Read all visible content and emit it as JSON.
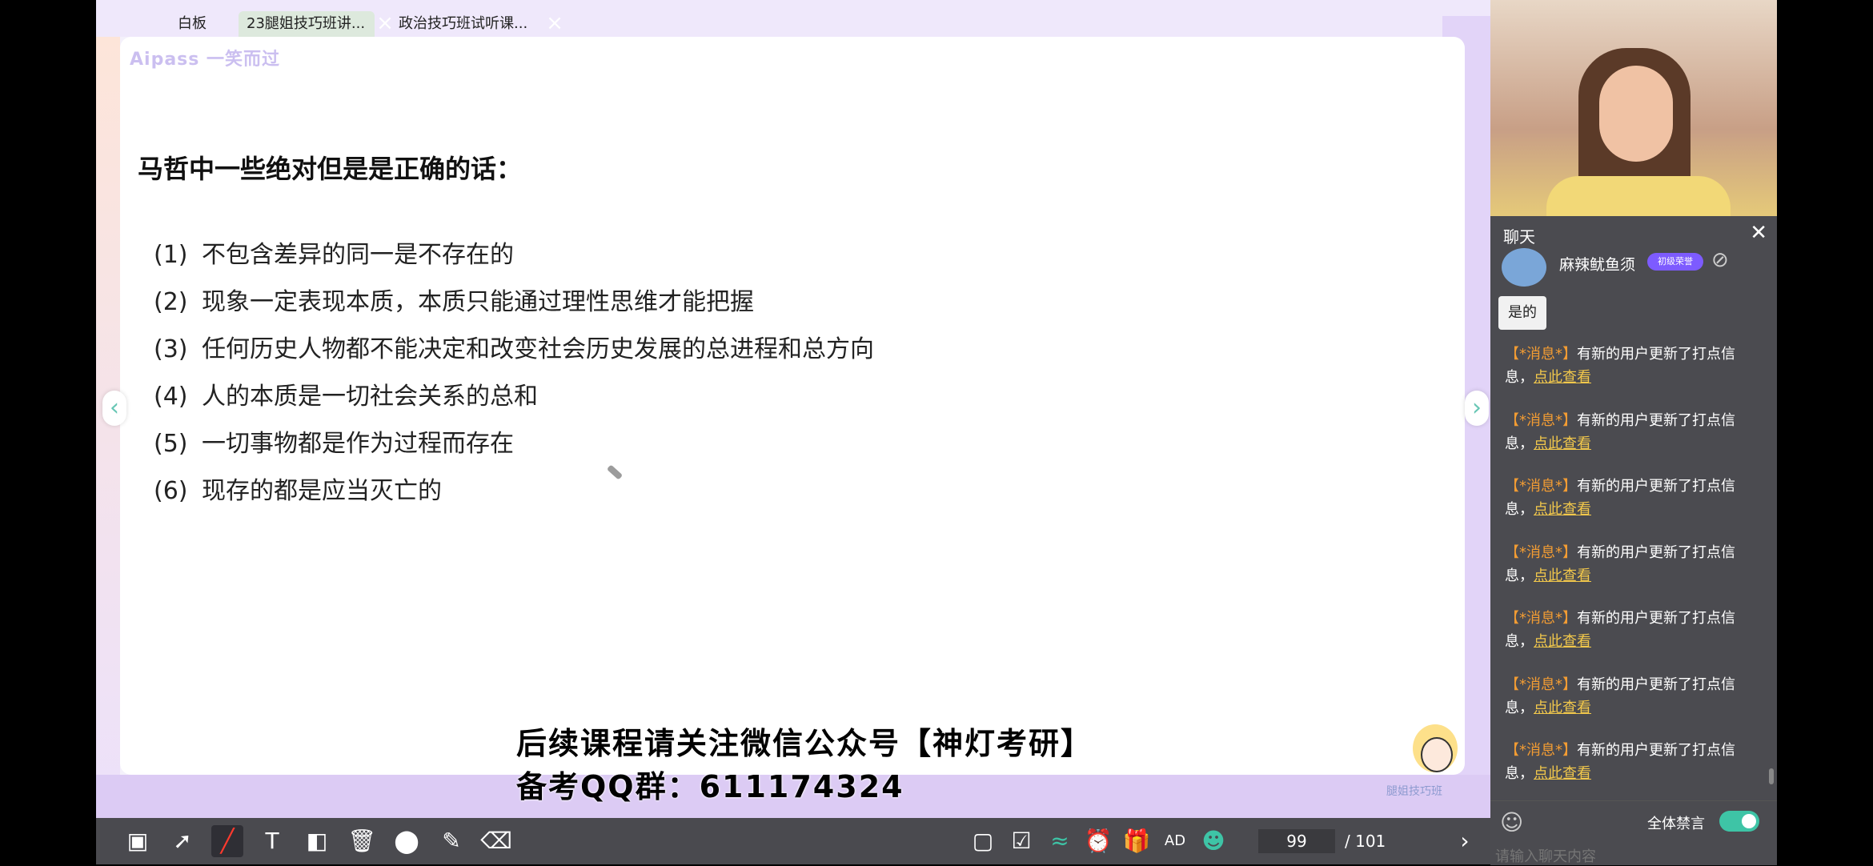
{
  "tabs": [
    {
      "label": "白板"
    },
    {
      "label": "23腿姐技巧班讲..."
    },
    {
      "label": "政治技巧班试听课..."
    }
  ],
  "slide": {
    "logo": "Aipass 一笑而过",
    "title": "马哲中一些绝对但是是正确的话：",
    "items": [
      {
        "num": "(1)",
        "text": "不包含差异的同一是不存在的"
      },
      {
        "num": "(2)",
        "text": "现象一定表现本质，本质只能通过理性思维才能把握"
      },
      {
        "num": "(3)",
        "text": "任何历史人物都不能决定和改变社会历史发展的总进程和总方向"
      },
      {
        "num": "(4)",
        "text": "人的本质是一切社会关系的总和"
      },
      {
        "num": "(5)",
        "text": "一切事物都是作为过程而存在"
      },
      {
        "num": "(6)",
        "text": "现存的都是应当灭亡的"
      }
    ],
    "nav_prev": "‹",
    "nav_next": "›",
    "mascot_label": "腿姐技巧班"
  },
  "captions": {
    "line1": "后续课程请关注微信公众号【神灯考研】",
    "line2": "备考QQ群：611174324"
  },
  "toolbar": {
    "page_current": "99",
    "page_total": "/ 101",
    "icons": [
      "ppt-icon",
      "pointer-icon",
      "pen-icon",
      "text-icon",
      "shape-icon",
      "trash-icon",
      "toggle-icon",
      "eraser-icon",
      "clear-icon",
      "record-icon",
      "clipboard-icon",
      "brush-icon",
      "timer-icon",
      "gift-icon",
      "ad-icon",
      "people-icon",
      "layers-icon"
    ]
  },
  "chat": {
    "title": "聊天",
    "close": "✕",
    "user": {
      "name": "麻辣鱿鱼须",
      "badge": "初级荣誉",
      "message": "是的"
    },
    "messages": [
      {
        "tag": "【*消息*】",
        "text": "有新的用户更新了打点信息，",
        "link": "点此查看"
      },
      {
        "tag": "【*消息*】",
        "text": "有新的用户更新了打点信息，",
        "link": "点此查看"
      },
      {
        "tag": "【*消息*】",
        "text": "有新的用户更新了打点信息，",
        "link": "点此查看"
      },
      {
        "tag": "【*消息*】",
        "text": "有新的用户更新了打点信息，",
        "link": "点此查看"
      },
      {
        "tag": "【*消息*】",
        "text": "有新的用户更新了打点信息，",
        "link": "点此查看"
      },
      {
        "tag": "【*消息*】",
        "text": "有新的用户更新了打点信息，",
        "link": "点此查看"
      },
      {
        "tag": "【*消息*】",
        "text": "有新的用户更新了打点信息，",
        "link": "点此查看"
      }
    ],
    "ban_all_label": "全体禁言",
    "ban_all_on": true,
    "input_placeholder": "请输入聊天内容"
  },
  "colors": {
    "accent": "#3ec4a6",
    "tag": "#f29c33",
    "link": "#f2c84b",
    "toolbar_bg": "#4a4a4f"
  }
}
